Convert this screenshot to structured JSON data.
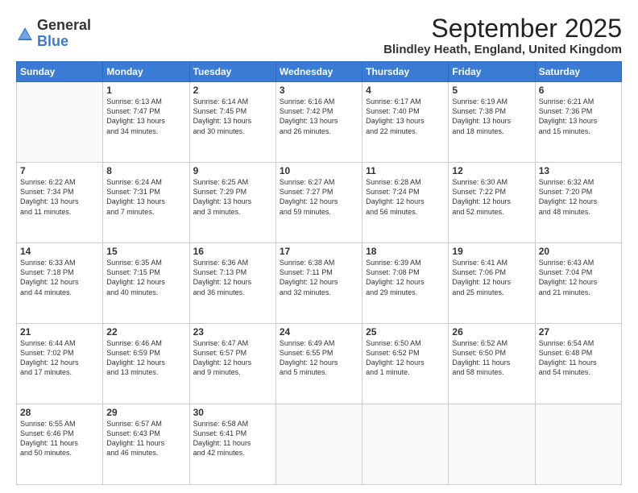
{
  "logo": {
    "general": "General",
    "blue": "Blue"
  },
  "header": {
    "month": "September 2025",
    "location": "Blindley Heath, England, United Kingdom"
  },
  "days_of_week": [
    "Sunday",
    "Monday",
    "Tuesday",
    "Wednesday",
    "Thursday",
    "Friday",
    "Saturday"
  ],
  "weeks": [
    [
      {
        "day": "",
        "info": ""
      },
      {
        "day": "1",
        "info": "Sunrise: 6:13 AM\nSunset: 7:47 PM\nDaylight: 13 hours\nand 34 minutes."
      },
      {
        "day": "2",
        "info": "Sunrise: 6:14 AM\nSunset: 7:45 PM\nDaylight: 13 hours\nand 30 minutes."
      },
      {
        "day": "3",
        "info": "Sunrise: 6:16 AM\nSunset: 7:42 PM\nDaylight: 13 hours\nand 26 minutes."
      },
      {
        "day": "4",
        "info": "Sunrise: 6:17 AM\nSunset: 7:40 PM\nDaylight: 13 hours\nand 22 minutes."
      },
      {
        "day": "5",
        "info": "Sunrise: 6:19 AM\nSunset: 7:38 PM\nDaylight: 13 hours\nand 18 minutes."
      },
      {
        "day": "6",
        "info": "Sunrise: 6:21 AM\nSunset: 7:36 PM\nDaylight: 13 hours\nand 15 minutes."
      }
    ],
    [
      {
        "day": "7",
        "info": "Sunrise: 6:22 AM\nSunset: 7:34 PM\nDaylight: 13 hours\nand 11 minutes."
      },
      {
        "day": "8",
        "info": "Sunrise: 6:24 AM\nSunset: 7:31 PM\nDaylight: 13 hours\nand 7 minutes."
      },
      {
        "day": "9",
        "info": "Sunrise: 6:25 AM\nSunset: 7:29 PM\nDaylight: 13 hours\nand 3 minutes."
      },
      {
        "day": "10",
        "info": "Sunrise: 6:27 AM\nSunset: 7:27 PM\nDaylight: 12 hours\nand 59 minutes."
      },
      {
        "day": "11",
        "info": "Sunrise: 6:28 AM\nSunset: 7:24 PM\nDaylight: 12 hours\nand 56 minutes."
      },
      {
        "day": "12",
        "info": "Sunrise: 6:30 AM\nSunset: 7:22 PM\nDaylight: 12 hours\nand 52 minutes."
      },
      {
        "day": "13",
        "info": "Sunrise: 6:32 AM\nSunset: 7:20 PM\nDaylight: 12 hours\nand 48 minutes."
      }
    ],
    [
      {
        "day": "14",
        "info": "Sunrise: 6:33 AM\nSunset: 7:18 PM\nDaylight: 12 hours\nand 44 minutes."
      },
      {
        "day": "15",
        "info": "Sunrise: 6:35 AM\nSunset: 7:15 PM\nDaylight: 12 hours\nand 40 minutes."
      },
      {
        "day": "16",
        "info": "Sunrise: 6:36 AM\nSunset: 7:13 PM\nDaylight: 12 hours\nand 36 minutes."
      },
      {
        "day": "17",
        "info": "Sunrise: 6:38 AM\nSunset: 7:11 PM\nDaylight: 12 hours\nand 32 minutes."
      },
      {
        "day": "18",
        "info": "Sunrise: 6:39 AM\nSunset: 7:08 PM\nDaylight: 12 hours\nand 29 minutes."
      },
      {
        "day": "19",
        "info": "Sunrise: 6:41 AM\nSunset: 7:06 PM\nDaylight: 12 hours\nand 25 minutes."
      },
      {
        "day": "20",
        "info": "Sunrise: 6:43 AM\nSunset: 7:04 PM\nDaylight: 12 hours\nand 21 minutes."
      }
    ],
    [
      {
        "day": "21",
        "info": "Sunrise: 6:44 AM\nSunset: 7:02 PM\nDaylight: 12 hours\nand 17 minutes."
      },
      {
        "day": "22",
        "info": "Sunrise: 6:46 AM\nSunset: 6:59 PM\nDaylight: 12 hours\nand 13 minutes."
      },
      {
        "day": "23",
        "info": "Sunrise: 6:47 AM\nSunset: 6:57 PM\nDaylight: 12 hours\nand 9 minutes."
      },
      {
        "day": "24",
        "info": "Sunrise: 6:49 AM\nSunset: 6:55 PM\nDaylight: 12 hours\nand 5 minutes."
      },
      {
        "day": "25",
        "info": "Sunrise: 6:50 AM\nSunset: 6:52 PM\nDaylight: 12 hours\nand 1 minute."
      },
      {
        "day": "26",
        "info": "Sunrise: 6:52 AM\nSunset: 6:50 PM\nDaylight: 11 hours\nand 58 minutes."
      },
      {
        "day": "27",
        "info": "Sunrise: 6:54 AM\nSunset: 6:48 PM\nDaylight: 11 hours\nand 54 minutes."
      }
    ],
    [
      {
        "day": "28",
        "info": "Sunrise: 6:55 AM\nSunset: 6:46 PM\nDaylight: 11 hours\nand 50 minutes."
      },
      {
        "day": "29",
        "info": "Sunrise: 6:57 AM\nSunset: 6:43 PM\nDaylight: 11 hours\nand 46 minutes."
      },
      {
        "day": "30",
        "info": "Sunrise: 6:58 AM\nSunset: 6:41 PM\nDaylight: 11 hours\nand 42 minutes."
      },
      {
        "day": "",
        "info": ""
      },
      {
        "day": "",
        "info": ""
      },
      {
        "day": "",
        "info": ""
      },
      {
        "day": "",
        "info": ""
      }
    ]
  ]
}
